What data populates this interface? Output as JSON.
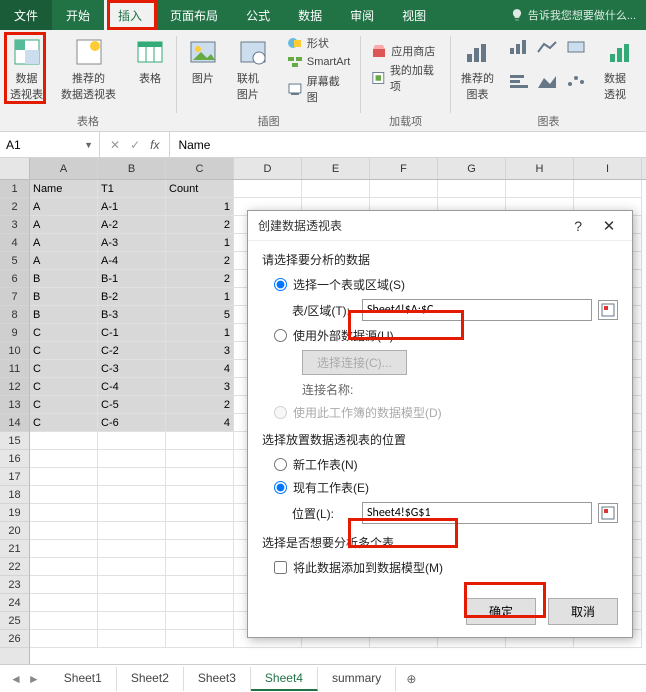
{
  "ribbon": {
    "tabs": [
      "文件",
      "开始",
      "插入",
      "页面布局",
      "公式",
      "数据",
      "审阅",
      "视图"
    ],
    "active_tab": 2,
    "tell_me": "告诉我您想要做什么...",
    "groups": {
      "tables": {
        "label": "表格",
        "pivot": "数据\n透视表",
        "recommended": "推荐的\n数据透视表",
        "table": "表格"
      },
      "illustrations": {
        "label": "插图",
        "picture": "图片",
        "online": "联机图片",
        "shapes": "形状",
        "smartart": "SmartArt",
        "screenshot": "屏幕截图"
      },
      "addins": {
        "label": "加载项",
        "store": "应用商店",
        "myaddins": "我的加载项"
      },
      "charts": {
        "label": "图表",
        "recommended": "推荐的\n图表",
        "pivotchart": "数据透视"
      }
    }
  },
  "namebox": {
    "value": "A1"
  },
  "formula": {
    "value": "Name"
  },
  "columns": [
    "A",
    "B",
    "C",
    "D",
    "E",
    "F",
    "G",
    "H",
    "I"
  ],
  "row_count": 26,
  "table": {
    "headers": [
      "Name",
      "T1",
      "Count"
    ],
    "rows": [
      [
        "A",
        "A-1",
        "1"
      ],
      [
        "A",
        "A-2",
        "2"
      ],
      [
        "A",
        "A-3",
        "1"
      ],
      [
        "A",
        "A-4",
        "2"
      ],
      [
        "B",
        "B-1",
        "2"
      ],
      [
        "B",
        "B-2",
        "1"
      ],
      [
        "B",
        "B-3",
        "5"
      ],
      [
        "C",
        "C-1",
        "1"
      ],
      [
        "C",
        "C-2",
        "3"
      ],
      [
        "C",
        "C-3",
        "4"
      ],
      [
        "C",
        "C-4",
        "3"
      ],
      [
        "C",
        "C-5",
        "2"
      ],
      [
        "C",
        "C-6",
        "4"
      ]
    ]
  },
  "dialog": {
    "title": "创建数据透视表",
    "section1": "请选择要分析的数据",
    "opt_select_range": "选择一个表或区域(S)",
    "range_label": "表/区域(T):",
    "range_value": "Sheet4!$A:$C",
    "opt_external": "使用外部数据源(U)",
    "choose_conn": "选择连接(C)...",
    "conn_name": "连接名称:",
    "opt_datamodel": "使用此工作簿的数据模型(D)",
    "section2": "选择放置数据透视表的位置",
    "opt_new_sheet": "新工作表(N)",
    "opt_existing": "现有工作表(E)",
    "loc_label": "位置(L):",
    "loc_value": "Sheet4!$G$1",
    "section3": "选择是否想要分析多个表",
    "chk_add_model": "将此数据添加到数据模型(M)",
    "ok": "确定",
    "cancel": "取消"
  },
  "sheets": {
    "tabs": [
      "Sheet1",
      "Sheet2",
      "Sheet3",
      "Sheet4",
      "summary"
    ],
    "active": 3
  }
}
